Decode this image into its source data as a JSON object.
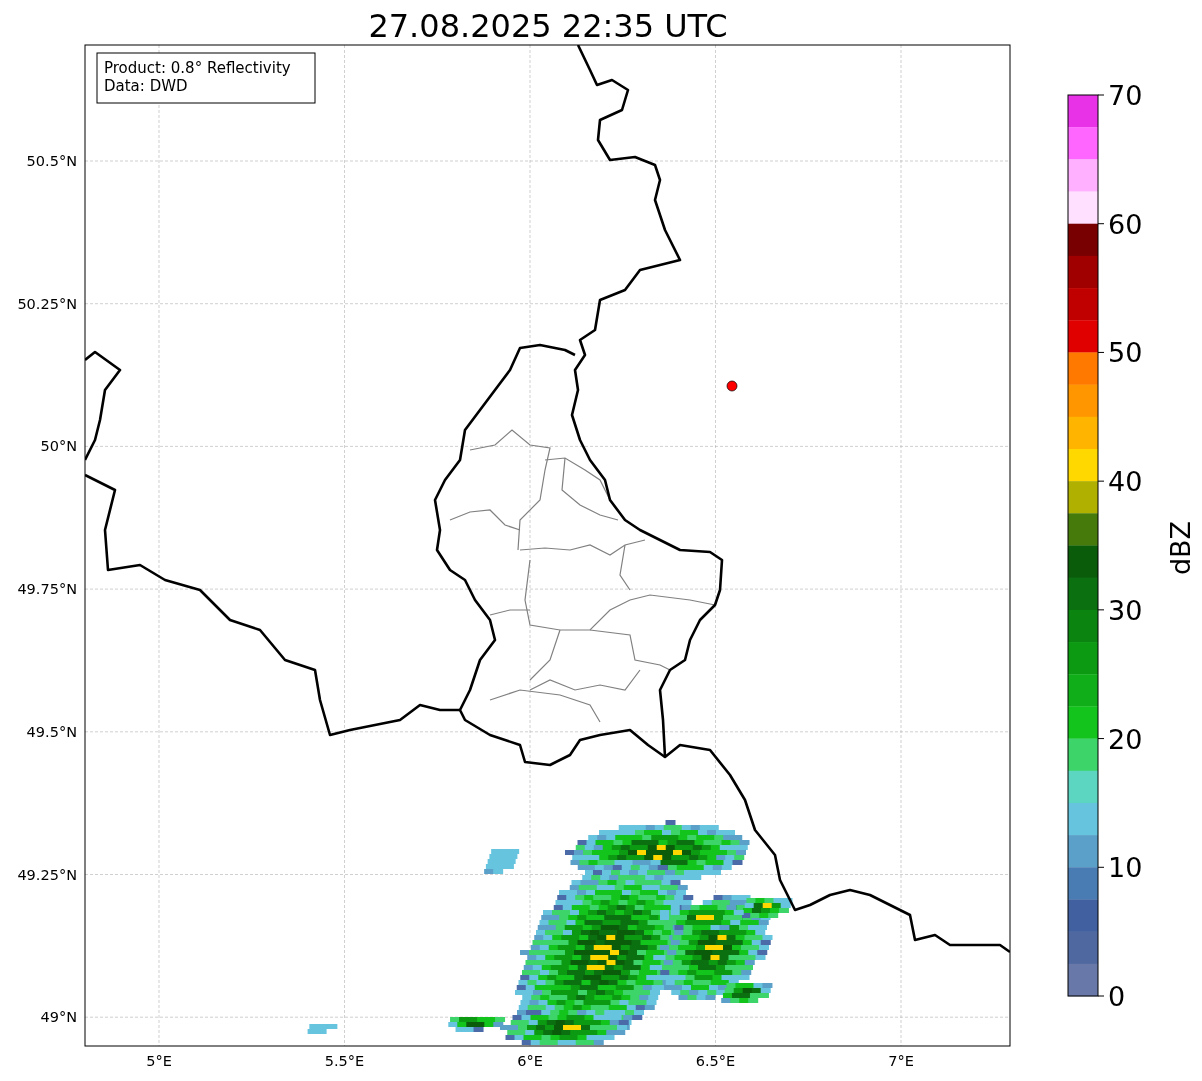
{
  "title": "27.08.2025 22:35 UTC",
  "info_box": [
    "Product: 0.8° Reflectivity",
    "Data: DWD"
  ],
  "map": {
    "x_ticks": [
      "5°E",
      "5.5°E",
      "6°E",
      "6.5°E",
      "7°E"
    ],
    "y_ticks": [
      "50.5°N",
      "50.25°N",
      "50°N",
      "49.75°N",
      "49.5°N",
      "49.25°N",
      "49°N"
    ]
  },
  "colorbar": {
    "label": "dBZ",
    "ticks": [
      "70",
      "60",
      "50",
      "40",
      "30",
      "20",
      "10",
      "0"
    ],
    "bins": [
      {
        "color": "#e832e8"
      },
      {
        "color": "#ff66ff"
      },
      {
        "color": "#ffb0ff"
      },
      {
        "color": "#ffe0ff"
      },
      {
        "color": "#780000"
      },
      {
        "color": "#a00000"
      },
      {
        "color": "#c00000"
      },
      {
        "color": "#e00000"
      },
      {
        "color": "#ff7800"
      },
      {
        "color": "#ff9600"
      },
      {
        "color": "#ffb400"
      },
      {
        "color": "#ffd800"
      },
      {
        "color": "#b0b000"
      },
      {
        "color": "#467a0a"
      },
      {
        "color": "#0a5c0a"
      },
      {
        "color": "#0a7010"
      },
      {
        "color": "#0b8510"
      },
      {
        "color": "#0c9a12"
      },
      {
        "color": "#10ae18"
      },
      {
        "color": "#12c41c"
      },
      {
        "color": "#3dd46a"
      },
      {
        "color": "#5cd6c0"
      },
      {
        "color": "#66c4de"
      },
      {
        "color": "#5aa0c8"
      },
      {
        "color": "#4a7cb4"
      },
      {
        "color": "#4060a0"
      },
      {
        "color": "#5068a0"
      },
      {
        "color": "#6878a8"
      }
    ]
  }
}
